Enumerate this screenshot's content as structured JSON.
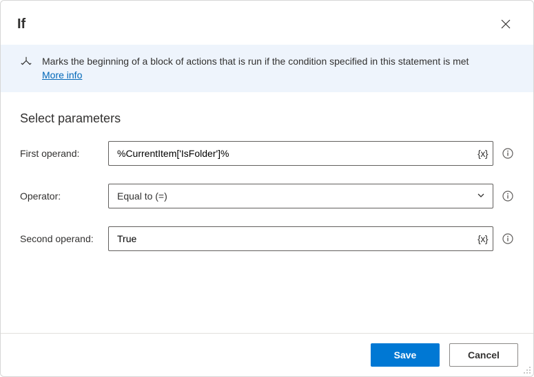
{
  "header": {
    "title": "If"
  },
  "banner": {
    "text": "Marks the beginning of a block of actions that is run if the condition specified in this statement is met",
    "more_link": "More info"
  },
  "section_title": "Select parameters",
  "params": {
    "first_label": "First operand:",
    "first_value": "%CurrentItem['IsFolder']%",
    "operator_label": "Operator:",
    "operator_value": "Equal to (=)",
    "second_label": "Second operand:",
    "second_value": "True",
    "var_token": "{x}"
  },
  "footer": {
    "save": "Save",
    "cancel": "Cancel"
  }
}
